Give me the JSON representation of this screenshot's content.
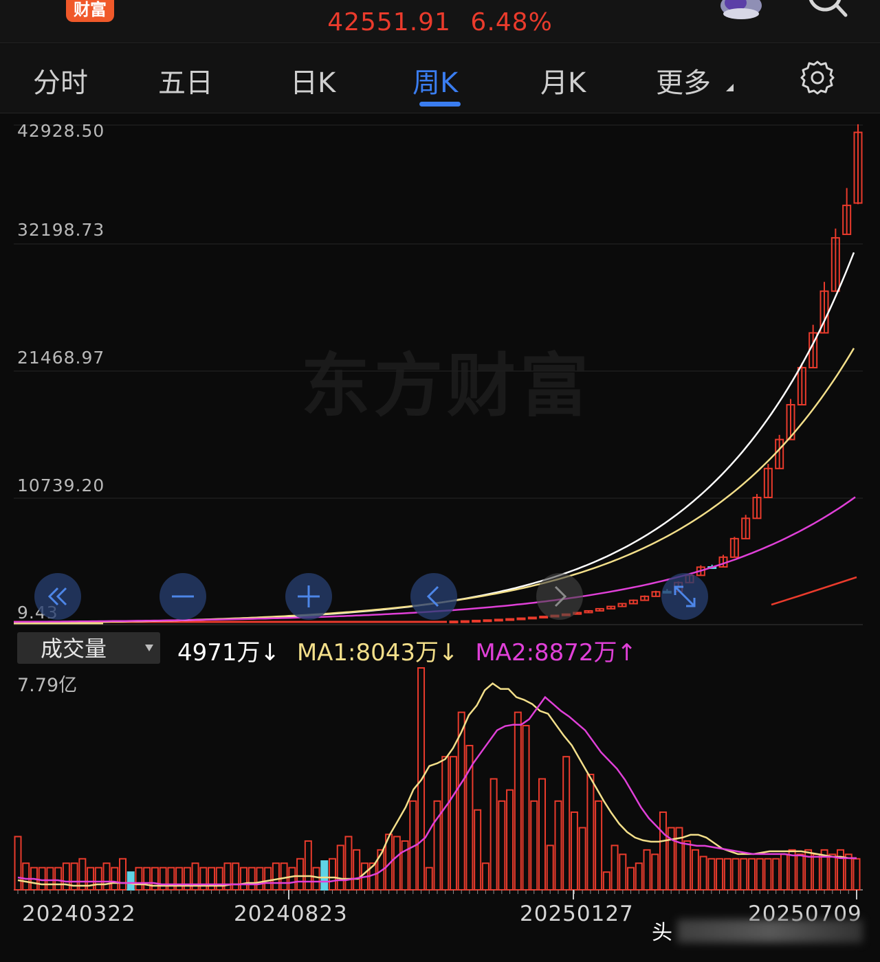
{
  "header": {
    "app_logo_text": "财富",
    "price": "42551.91",
    "change_pct": "6.48%"
  },
  "tabs": [
    {
      "label": "分时",
      "active": false
    },
    {
      "label": "五日",
      "active": false
    },
    {
      "label": "日K",
      "active": false
    },
    {
      "label": "周K",
      "active": true
    },
    {
      "label": "月K",
      "active": false
    },
    {
      "label": "更多",
      "active": false
    }
  ],
  "watermark": "东方财富",
  "chart_controls": [
    "jump-to-start-icon",
    "zoom-out-icon",
    "zoom-in-icon",
    "scroll-left-icon",
    "scroll-right-icon",
    "fullscreen-icon"
  ],
  "colors": {
    "up": "#ea3b2c",
    "down": "#5fd3e6",
    "ma1": "#f3df8a",
    "ma2": "#e040d8",
    "ma_white": "#ffffff",
    "accent": "#3a7df0"
  },
  "volume_panel": {
    "selector_label": "成交量",
    "current": "4971万↓",
    "ma1": "MA1:8043万↓",
    "ma2": "MA2:8872万↑",
    "max_label": "7.79亿"
  },
  "chart_data": {
    "type": "candlestick",
    "period": "weekly",
    "y_axis_labels": [
      "42928.50",
      "32198.73",
      "21468.97",
      "10739.20",
      "9.43"
    ],
    "ylim": [
      9.43,
      42928.5
    ],
    "x_axis_labels": [
      "20240322",
      "20240823",
      "20250127",
      "20250709"
    ],
    "last_close": 42551.91,
    "candles": [
      {
        "o": 80,
        "c": 120,
        "h": 130,
        "l": 70
      },
      {
        "o": 120,
        "c": 150,
        "h": 160,
        "l": 110
      },
      {
        "o": 150,
        "c": 190,
        "h": 200,
        "l": 140
      },
      {
        "o": 190,
        "c": 230,
        "h": 240,
        "l": 180
      },
      {
        "o": 230,
        "c": 280,
        "h": 290,
        "l": 220
      },
      {
        "o": 280,
        "c": 330,
        "h": 340,
        "l": 270
      },
      {
        "o": 330,
        "c": 390,
        "h": 400,
        "l": 320
      },
      {
        "o": 390,
        "c": 460,
        "h": 470,
        "l": 380
      },
      {
        "o": 460,
        "c": 540,
        "h": 560,
        "l": 450
      },
      {
        "o": 540,
        "c": 630,
        "h": 650,
        "l": 530
      },
      {
        "o": 630,
        "c": 740,
        "h": 760,
        "l": 620
      },
      {
        "o": 740,
        "c": 870,
        "h": 900,
        "l": 730
      },
      {
        "o": 870,
        "c": 1020,
        "h": 1050,
        "l": 860
      },
      {
        "o": 1020,
        "c": 1200,
        "h": 1240,
        "l": 1010
      },
      {
        "o": 1200,
        "c": 1400,
        "h": 1450,
        "l": 1190
      },
      {
        "o": 1400,
        "c": 1640,
        "h": 1700,
        "l": 1390
      },
      {
        "o": 1640,
        "c": 1930,
        "h": 2000,
        "l": 1630
      },
      {
        "o": 1930,
        "c": 2270,
        "h": 2350,
        "l": 1920
      },
      {
        "o": 2270,
        "c": 2660,
        "h": 2750,
        "l": 2260
      },
      {
        "o": 2660,
        "c": 2690,
        "h": 2900,
        "l": 2640
      },
      {
        "o": 2690,
        "c": 3460,
        "h": 3560,
        "l": 2680
      },
      {
        "o": 3460,
        "c": 4080,
        "h": 4200,
        "l": 3440
      },
      {
        "o": 4080,
        "c": 4790,
        "h": 4950,
        "l": 4060
      },
      {
        "o": 4790,
        "c": 4810,
        "h": 5000,
        "l": 4770
      },
      {
        "o": 4810,
        "c": 5650,
        "h": 5850,
        "l": 4790
      },
      {
        "o": 5650,
        "c": 7250,
        "h": 7400,
        "l": 5640
      },
      {
        "o": 7250,
        "c": 9000,
        "h": 9300,
        "l": 7240
      },
      {
        "o": 9000,
        "c": 10800,
        "h": 11100,
        "l": 8980
      },
      {
        "o": 10800,
        "c": 13300,
        "h": 13700,
        "l": 10780
      },
      {
        "o": 13300,
        "c": 15800,
        "h": 16200,
        "l": 13280
      },
      {
        "o": 15800,
        "c": 18800,
        "h": 19300,
        "l": 15780
      },
      {
        "o": 18800,
        "c": 22000,
        "h": 22400,
        "l": 18780
      },
      {
        "o": 22000,
        "c": 25000,
        "h": 25700,
        "l": 21980
      },
      {
        "o": 25000,
        "c": 28600,
        "h": 29400,
        "l": 24980
      },
      {
        "o": 28600,
        "c": 33200,
        "h": 34000,
        "l": 28580
      },
      {
        "o": 33500,
        "c": 36000,
        "h": 37500,
        "l": 33480
      },
      {
        "o": 36200,
        "c": 42300,
        "h": 43000,
        "l": 36100
      }
    ],
    "volume_ylim": [
      0,
      779000000
    ],
    "volume": [
      24,
      12,
      10,
      10,
      10,
      10,
      12,
      12,
      14,
      10,
      10,
      12,
      10,
      14,
      -8,
      10,
      10,
      10,
      10,
      10,
      10,
      10,
      12,
      10,
      10,
      10,
      12,
      12,
      10,
      10,
      10,
      10,
      12,
      12,
      10,
      14,
      22,
      10,
      -13,
      14,
      20,
      24,
      18,
      12,
      12,
      18,
      25,
      24,
      22,
      40,
      100,
      10,
      40,
      60,
      60,
      80,
      65,
      36,
      12,
      50,
      40,
      45,
      80,
      74,
      40,
      50,
      20,
      40,
      60,
      35,
      28,
      52,
      40,
      8,
      20,
      16,
      10,
      12,
      18,
      16,
      35,
      28,
      28,
      22,
      18,
      15,
      14,
      14,
      14,
      14,
      14,
      14,
      14,
      14,
      14,
      16,
      18,
      16,
      18,
      16,
      18,
      16,
      18,
      16,
      14
    ],
    "volume_ma1": [
      7,
      6,
      5,
      4,
      4,
      4,
      4,
      3,
      3,
      3,
      4,
      4,
      5,
      5,
      5,
      4,
      4,
      3,
      3,
      3,
      3,
      3,
      3,
      3,
      3,
      3,
      3,
      4,
      4,
      5,
      5,
      6,
      7,
      8,
      9,
      10,
      10,
      10,
      9,
      9,
      9,
      8,
      8,
      8,
      13,
      18,
      27,
      40,
      50,
      60,
      73,
      80,
      90,
      92,
      95,
      103,
      114,
      127,
      134,
      145,
      150,
      146,
      146,
      140,
      138,
      135,
      130,
      128,
      120,
      112,
      105,
      95,
      85,
      75,
      65,
      56,
      48,
      42,
      38,
      36,
      35,
      35,
      36,
      37,
      38,
      40,
      40,
      38,
      34,
      30,
      28,
      26,
      26,
      26,
      27,
      28,
      28,
      28,
      28,
      28,
      27,
      26,
      25,
      24,
      24,
      23,
      23
    ],
    "volume_ma2": [
      9,
      8,
      8,
      7,
      7,
      7,
      6,
      6,
      6,
      6,
      6,
      6,
      6,
      5,
      5,
      5,
      5,
      5,
      4,
      4,
      4,
      4,
      4,
      4,
      4,
      4,
      4,
      4,
      4,
      4,
      4,
      5,
      5,
      5,
      5,
      6,
      6,
      6,
      6,
      6,
      7,
      7,
      8,
      9,
      10,
      12,
      16,
      22,
      27,
      30,
      33,
      38,
      48,
      56,
      64,
      73,
      82,
      92,
      100,
      108,
      116,
      119,
      120,
      120,
      124,
      132,
      140,
      135,
      130,
      126,
      121,
      116,
      108,
      100,
      94,
      88,
      80,
      70,
      60,
      52,
      46,
      40,
      36,
      34,
      33,
      32,
      32,
      31,
      30,
      29,
      28,
      27,
      26,
      26,
      26,
      26,
      26,
      25,
      25,
      24,
      24,
      24,
      24,
      23,
      23,
      23
    ],
    "ma_lines": [
      {
        "name": "white",
        "color": "#ffffff"
      },
      {
        "name": "MA-yellow",
        "color": "#f3df8a"
      },
      {
        "name": "MA-magenta",
        "color": "#e040d8"
      },
      {
        "name": "MA-red",
        "color": "#ea3b2c"
      }
    ]
  }
}
